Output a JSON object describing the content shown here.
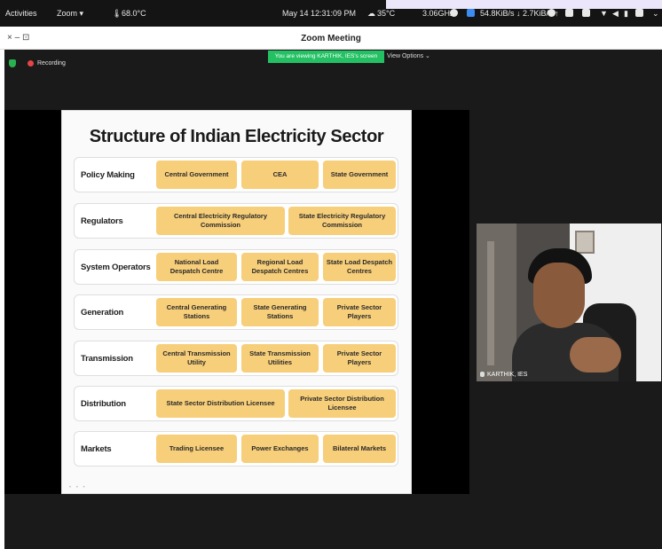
{
  "system_bar": {
    "activities": "Activities",
    "app": "Zoom ▾",
    "cpu_temp": "68.0°C",
    "clock": "May 14  12:31:09 PM",
    "weather": "35°C",
    "cpu_freq": "3.06GHz",
    "net_speed": "54.8KiB/s ↓ 2.7KiB/s ↑"
  },
  "window": {
    "title": "Zoom Meeting",
    "controls": "×  –  ⊡"
  },
  "meeting": {
    "share_banner": "You are viewing KARTHIK, IES's screen",
    "view_options": "View Options ⌄",
    "recording_label": "Recording"
  },
  "slide": {
    "title": "Structure of Indian Electricity Sector",
    "rows": [
      {
        "label": "Policy Making",
        "items": [
          "Central Government",
          "CEA",
          "State Government"
        ]
      },
      {
        "label": "Regulators",
        "items": [
          "Central Electricity Regulatory Commission",
          "State Electricity Regulatory Commission"
        ]
      },
      {
        "label": "System Operators",
        "items": [
          "National Load Despatch Centre",
          "Regional Load Despatch Centres",
          "State Load Despatch Centres"
        ]
      },
      {
        "label": "Generation",
        "items": [
          "Central Generating Stations",
          "State Generating Stations",
          "Private Sector Players"
        ]
      },
      {
        "label": "Transmission",
        "items": [
          "Central Transmission Utility",
          "State Transmission Utilities",
          "Private Sector Players"
        ]
      },
      {
        "label": "Distribution",
        "items": [
          "State Sector Distribution Licensee",
          "Private Sector Distribution Licensee"
        ]
      },
      {
        "label": "Markets",
        "items": [
          "Trading Licensee",
          "Power Exchanges",
          "Bilateral Markets"
        ]
      }
    ]
  },
  "participant": {
    "name": "KARTHIK, IES"
  },
  "colors": {
    "box_fill": "#f7ce79",
    "share_banner": "#23c163",
    "recording_dot": "#e54545"
  }
}
